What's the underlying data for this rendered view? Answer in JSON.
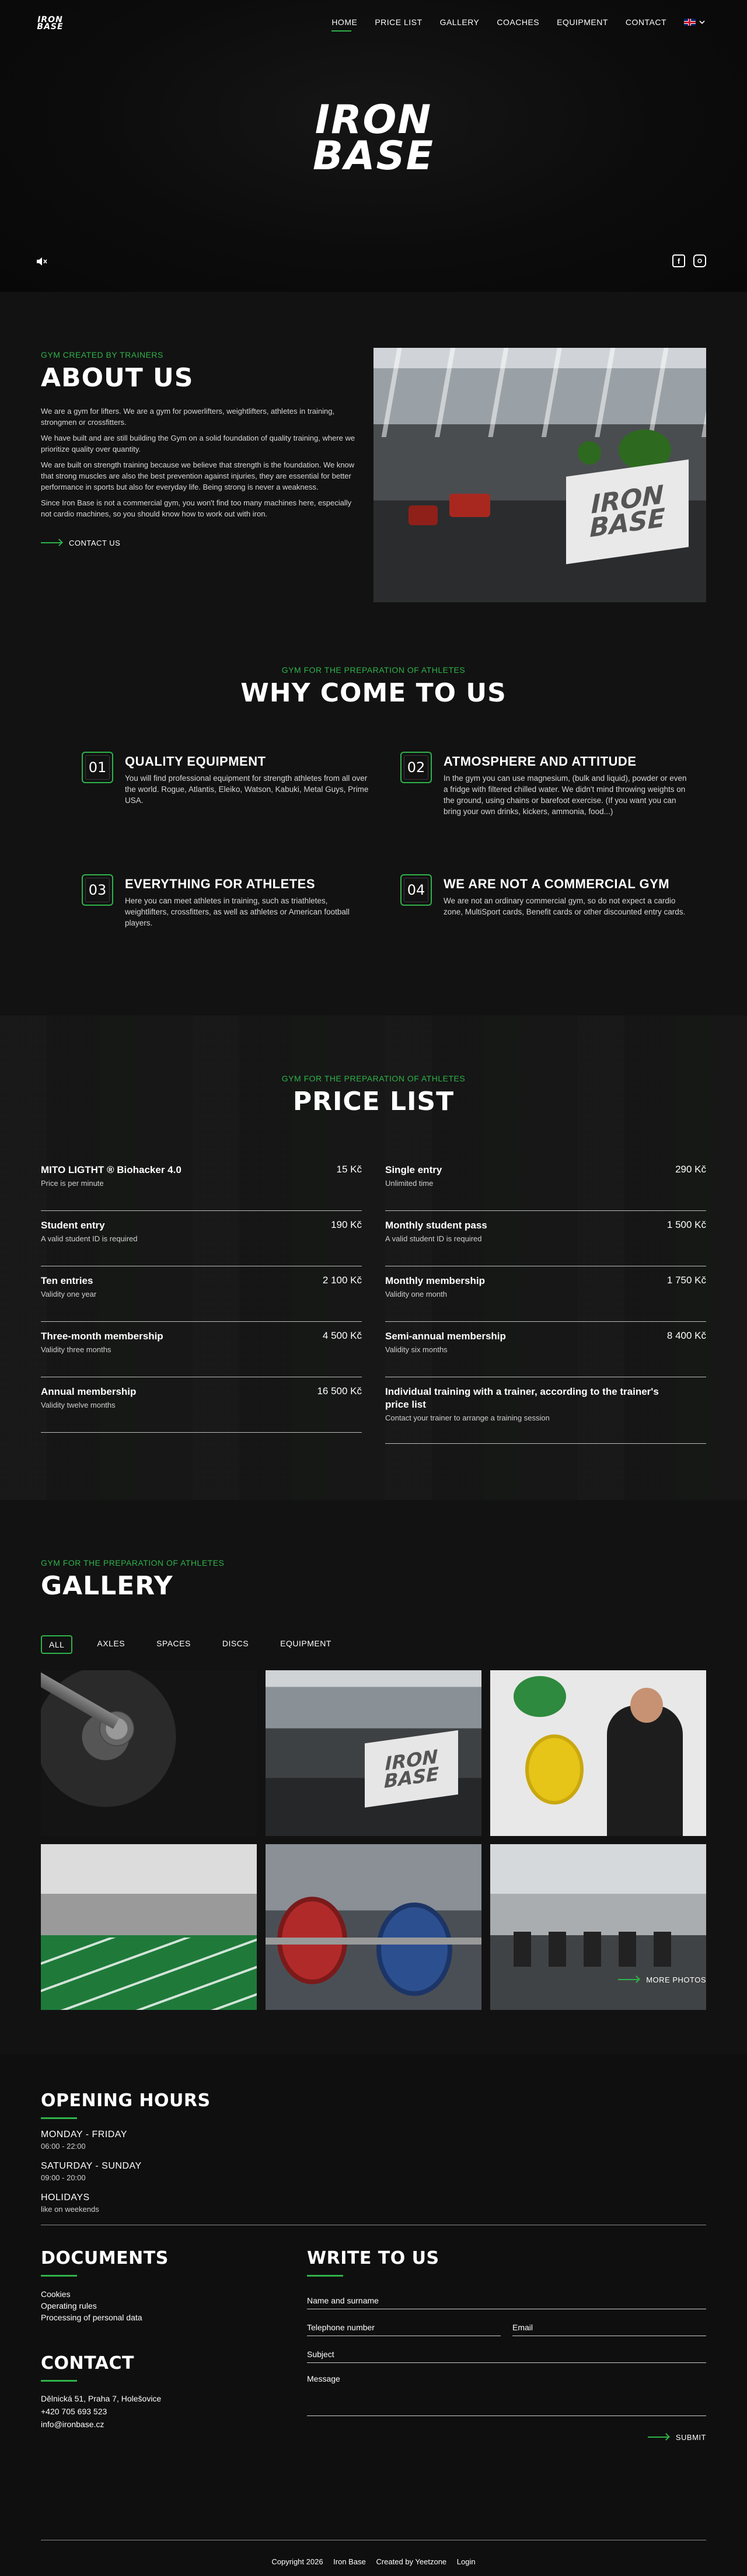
{
  "brand": {
    "logo_line1": "IRON",
    "logo_line2": "BASE"
  },
  "nav": {
    "items": [
      "HOME",
      "PRICE LIST",
      "GALLERY",
      "COACHES",
      "EQUIPMENT",
      "CONTACT"
    ],
    "active": "HOME",
    "language_icon": "uk-flag-icon"
  },
  "hero": {
    "mute_icon": "mute-icon",
    "social_icons": [
      "facebook-icon",
      "instagram-icon"
    ]
  },
  "about": {
    "eyebrow": "GYM CREATED BY TRAINERS",
    "title": "ABOUT US",
    "paragraphs": [
      "We are a gym for lifters. We are a gym for powerlifters, weightlifters, athletes in training, strongmen or crossfitters.",
      "We have built and are still building the Gym on a solid foundation of quality training, where we prioritize quality over quantity.",
      "We are built on strength training because we believe that strength is the foundation. We know that strong muscles are also the best prevention against injuries, they are essential for better performance in sports but also for everyday life. Being strong is never a weakness.",
      "Since Iron Base is not a commercial gym, you won't find too many machines here, especially not cardio machines, so you should know how to work out with iron."
    ],
    "cta": "CONTACT US",
    "image_wall_text1": "IRON",
    "image_wall_text2": "BASE"
  },
  "why": {
    "eyebrow": "GYM FOR THE PREPARATION OF ATHLETES",
    "title": "WHY COME TO US",
    "features": [
      {
        "num": "01",
        "title": "QUALITY EQUIPMENT",
        "text": "You will find professional equipment for strength athletes from all over the world. Rogue, Atlantis, Eleiko, Watson, Kabuki, Metal Guys, Prime USA."
      },
      {
        "num": "02",
        "title": "ATMOSPHERE AND ATTITUDE",
        "text": "In the gym you can use magnesium, (bulk and liquid), powder or even a fridge with filtered chilled water. We didn't mind throwing weights on the ground, using chains or barefoot exercise. (If you want you can bring your own drinks, kickers, ammonia, food...)"
      },
      {
        "num": "03",
        "title": "EVERYTHING FOR ATHLETES",
        "text": "Here you can meet athletes in training, such as triathletes, weightlifters, crossfitters, as well as athletes or American football players."
      },
      {
        "num": "04",
        "title": "WE ARE NOT A COMMERCIAL GYM",
        "text": "We are not an ordinary commercial gym, so do not expect a cardio zone, MultiSport cards, Benefit cards or other discounted entry cards."
      }
    ]
  },
  "price": {
    "eyebrow": "GYM FOR THE PREPARATION OF ATHLETES",
    "title": "PRICE LIST",
    "left": [
      {
        "name": "MITO LIGTHT ® Biohacker 4.0",
        "price": "15 Kč",
        "sub": "Price is per minute"
      },
      {
        "name": "Student entry",
        "price": "190 Kč",
        "sub": "A valid student ID is required"
      },
      {
        "name": "Ten entries",
        "price": "2 100 Kč",
        "sub": "Validity one year"
      },
      {
        "name": "Three-month membership",
        "price": "4 500 Kč",
        "sub": "Validity three months"
      },
      {
        "name": "Annual membership",
        "price": "16 500 Kč",
        "sub": "Validity twelve months"
      }
    ],
    "right": [
      {
        "name": "Single entry",
        "price": "290 Kč",
        "sub": "Unlimited time"
      },
      {
        "name": "Monthly student pass",
        "price": "1 500 Kč",
        "sub": "A valid student ID is required"
      },
      {
        "name": "Monthly membership",
        "price": "1 750 Kč",
        "sub": "Validity one month"
      },
      {
        "name": "Semi-annual membership",
        "price": "8 400 Kč",
        "sub": "Validity six months"
      },
      {
        "name": "Individual training with a trainer, according to the trainer's price list",
        "price": "",
        "sub": "Contact your trainer to arrange a training session"
      }
    ]
  },
  "gallery": {
    "eyebrow": "GYM FOR THE PREPARATION OF ATHLETES",
    "title": "GALLERY",
    "filters": [
      "ALL",
      "AXLES",
      "SPACES",
      "DISCS",
      "EQUIPMENT"
    ],
    "active_filter": "ALL",
    "more": "MORE PHOTOS"
  },
  "footer": {
    "hours_title": "OPENING HOURS",
    "hours": [
      {
        "days": "MONDAY - FRIDAY",
        "time": "06:00 - 22:00"
      },
      {
        "days": "SATURDAY - SUNDAY",
        "time": "09:00 - 20:00"
      },
      {
        "days": "HOLIDAYS",
        "time": "like on weekends"
      }
    ],
    "docs_title": "DOCUMENTS",
    "docs": [
      "Cookies",
      "Operating rules",
      "Processing of personal data"
    ],
    "contact_title": "CONTACT",
    "contact": [
      "Dělnická 51, Praha 7, Holešovice",
      "+420 705 693 523",
      "info@ironbase.cz"
    ],
    "form_title": "WRITE TO US",
    "form": {
      "name": "Name and surname",
      "phone": "Telephone number",
      "email": "Email",
      "subject": "Subject",
      "message": "Message",
      "submit": "SUBMIT"
    },
    "copyright": "Copyright 2026",
    "brand": "Iron Base",
    "created": "Created by Yeetzone",
    "login": "Login"
  },
  "colors": {
    "accent": "#2fb34a",
    "background": "#121212",
    "text": "#ffffff"
  }
}
